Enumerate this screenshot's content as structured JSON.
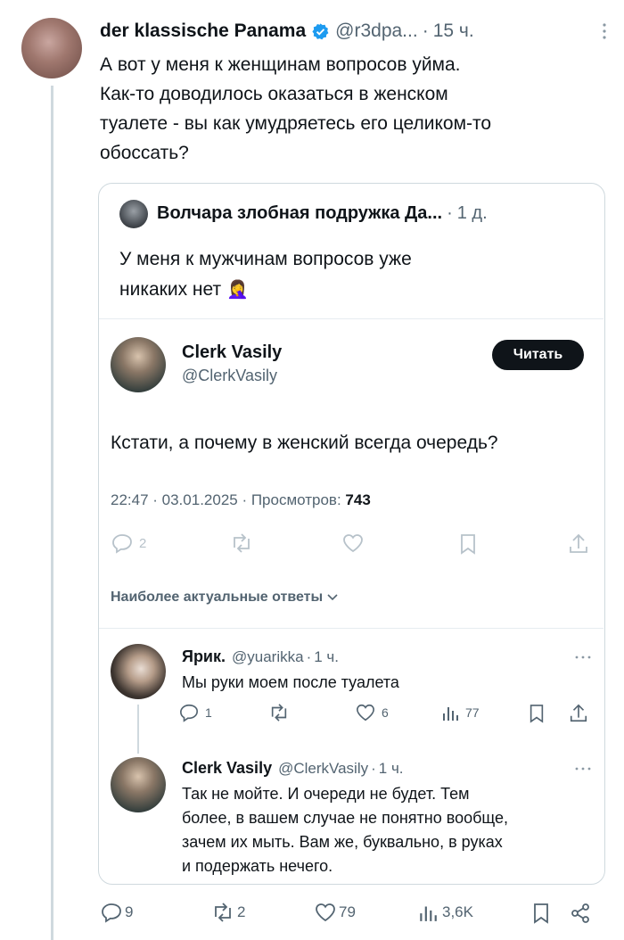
{
  "main_tweet": {
    "display_name": "der klassische Panama",
    "handle": "@r3dpa...",
    "time": "15 ч.",
    "text_lines": [
      "А вот у меня к женщинам вопросов уйма.",
      "Как-то доводилось оказаться в женском",
      "туалете - вы как умудряетесь его целиком-то",
      "обоссать?"
    ],
    "stats": {
      "replies": "9",
      "reposts": "2",
      "likes": "79",
      "views": "3,6K"
    }
  },
  "quoted": {
    "display_name": "Волчара злобная подружка Да...",
    "time": "1 д.",
    "text_lines": [
      "У меня к мужчинам вопросов уже",
      "никаких нет"
    ],
    "emoji": "🤦‍♀️"
  },
  "embedded": {
    "display_name": "Clerk Vasily",
    "handle": "@ClerkVasily",
    "follow_label": "Читать",
    "text": "Кстати, а почему в женский всегда очередь?",
    "meta_prefix": "22:47 · 03.01.2025 · Просмотров:",
    "meta_views": "743",
    "reply_count": "2",
    "sort_label": "Наиболее актуальные ответы",
    "replies": [
      {
        "display_name": "Ярик.",
        "handle": "@yuarikka",
        "time": "1 ч.",
        "text_lines": [
          "Мы руки моем после туалета"
        ],
        "stats": {
          "replies": "1",
          "likes": "6",
          "views": "77"
        }
      },
      {
        "display_name": "Clerk Vasily",
        "handle": "@ClerkVasily",
        "time": "1 ч.",
        "text_lines": [
          "Так не мойте. И очереди не будет. Тем",
          "более, в вашем случае не понятно вообще,",
          "зачем их мыть. Вам же, буквально, в руках",
          "и подержать нечего."
        ]
      }
    ]
  },
  "colors": {
    "verified": "#1d9bf0",
    "muted": "#536471",
    "border": "#cfd9de"
  }
}
